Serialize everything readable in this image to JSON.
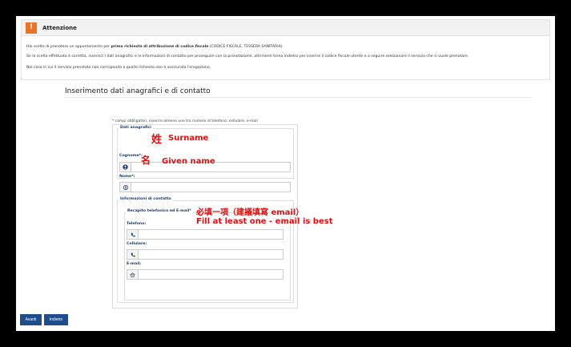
{
  "attention": {
    "icon": "warning-icon",
    "icon_symbol": "!",
    "title": "Attenzione",
    "line1_pre": "Hai scelto di prenotare un appuntamento per ",
    "line1_bold": "prima richiesta di attribuzione di codice fiscale",
    "line1_post": " (CODICE FISCALE, TESSERA SANITARIA).",
    "line2": "Se la scelta effettuata è corretta, inserisci i dati anagrafici e le informazioni di contatto per proseguire con la prenotazione, altrimenti torna indietro per inserire il codice fiscale utente e a seguire selezionare il servizio che si vuole prenotare.",
    "line3": "Nel caso in cui il servizio prenotato non corrisponda a quello richiesto non è assicurata l'erogazione."
  },
  "page_title": "Inserimento dati anagrafici e di contatto",
  "required_note": "* campi obbligatori, inserire almeno uno tra numero di telefono, cellulare, e-mail",
  "anagrafici": {
    "legend": "Dati anagrafici",
    "surname_label": "Cognome*:",
    "surname_icon": "user-circle-icon",
    "surname_value": "",
    "name_label": "Nome*:",
    "name_icon": "user-icon",
    "name_value": ""
  },
  "contatto": {
    "legend": "Informazioni di contatto",
    "sub_legend": "Recapito telefonico ed E-mail*",
    "phone_label": "Telefono:",
    "phone_icon": "phone-icon",
    "mobile_label": "Cellulare:",
    "mobile_icon": "phone-icon",
    "email_label": "E-mail:",
    "email_icon": "home-icon"
  },
  "annotations": {
    "surname_zh": "姓",
    "surname_en": "Surname",
    "given_zh": "名",
    "given_en": "Given name",
    "contact_zh": "必填一項（建議填寫 email）",
    "contact_en": "Fill at least one - email is best"
  },
  "buttons": {
    "next": "Avanti",
    "back": "Indietro"
  },
  "colors": {
    "accent": "#1f4e8c",
    "warning": "#e8742a",
    "annotation": "#e01010"
  }
}
